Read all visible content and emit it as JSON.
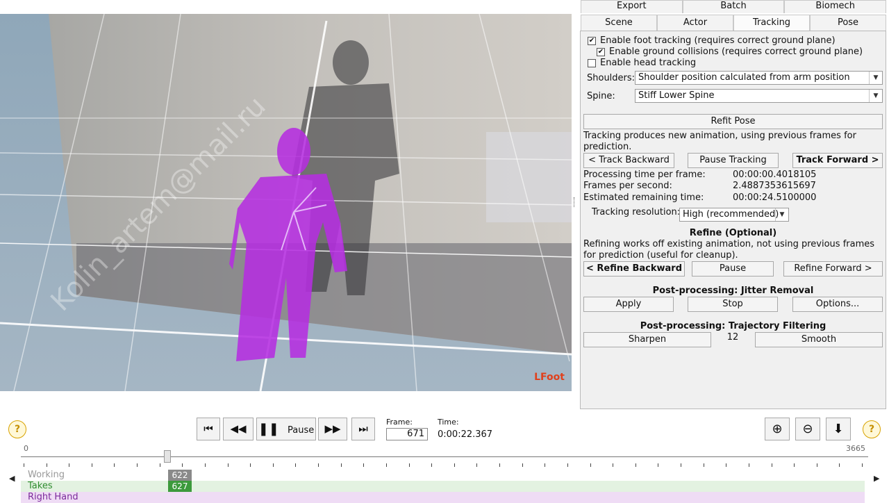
{
  "tabs_row1": [
    "Export",
    "Batch",
    "Biomech"
  ],
  "tabs_row2": [
    "Scene",
    "Actor",
    "Tracking",
    "Pose"
  ],
  "active_tab": "Tracking",
  "tracking": {
    "foot_tracking": {
      "label": "Enable foot tracking (requires correct ground plane)",
      "checked": true
    },
    "ground_collisions": {
      "label": "Enable ground collisions (requires correct ground plane)",
      "checked": true
    },
    "head_tracking": {
      "label": "Enable head tracking",
      "checked": false
    },
    "shoulders_label": "Shoulders:",
    "shoulders_value": "Shoulder position calculated from arm position",
    "spine_label": "Spine:",
    "spine_value": "Stiff Lower Spine",
    "refit_pose": "Refit Pose",
    "description": "Tracking produces new animation, using previous frames for prediction.",
    "track_backward": "< Track Backward",
    "pause_tracking": "Pause Tracking",
    "track_forward": "Track Forward >",
    "stats": [
      {
        "label": "Processing time per frame:",
        "value": "00:00:00.4018105"
      },
      {
        "label": "Frames per second:",
        "value": "2.4887353615697"
      },
      {
        "label": "Estimated remaining time:",
        "value": "00:00:24.5100000"
      }
    ],
    "resolution_label": "Tracking resolution:",
    "resolution_value": "High (recommended)"
  },
  "refine": {
    "title": "Refine (Optional)",
    "description": "Refining works off existing animation, not using previous frames for prediction (useful for cleanup).",
    "backward": "< Refine Backward",
    "pause": "Pause",
    "forward": "Refine Forward >"
  },
  "jitter": {
    "title": "Post-processing: Jitter Removal",
    "apply": "Apply",
    "stop": "Stop",
    "options": "Options..."
  },
  "trajectory": {
    "title": "Post-processing: Trajectory Filtering",
    "sharpen": "Sharpen",
    "value": "12",
    "smooth": "Smooth"
  },
  "viewport": {
    "label": "LFoot",
    "watermark": "Kolin_artem@mail.ru"
  },
  "transport": {
    "pause_label": "Pause",
    "frame_label": "Frame:",
    "frame_value": "671",
    "time_label": "Time:",
    "time_value": "0:00:22.367"
  },
  "timeline": {
    "start": "0",
    "end": "3665",
    "current_frame": 671,
    "tracks": [
      {
        "name": "Working",
        "marker": "622",
        "color": "#8a8a8a"
      },
      {
        "name": "Takes",
        "marker": "627",
        "color": "#3c9a3c"
      },
      {
        "name": "Right Hand",
        "marker": "",
        "color": "#7a2a9a"
      }
    ]
  },
  "colors": {
    "skeleton": "#b52ee0",
    "grid": "#ffffff",
    "label_red": "#e0401c"
  }
}
